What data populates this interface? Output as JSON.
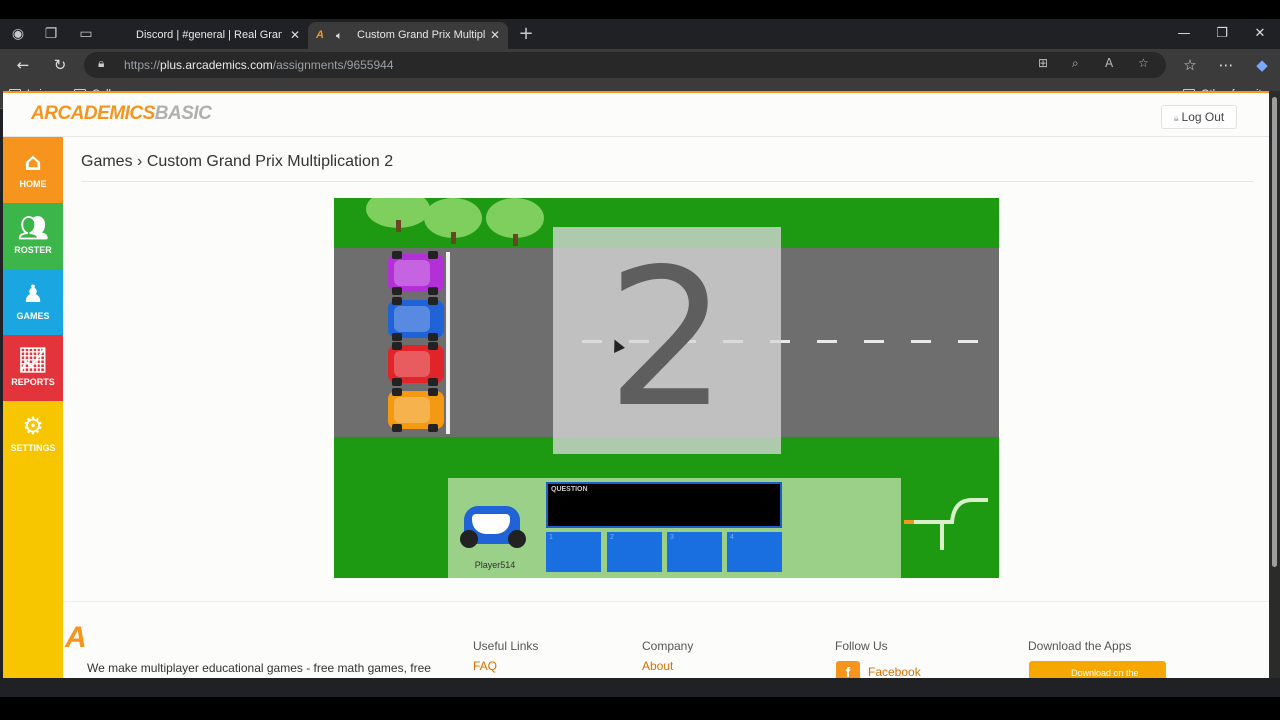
{
  "browser": {
    "tabs": [
      {
        "title": "Discord | #general | Real Grand Pr",
        "active": false
      },
      {
        "title": "Custom Grand Prix Multiplicati",
        "active": true
      }
    ],
    "url_prefix": "https://",
    "url_host": "plus.arcademics.com",
    "url_path": "/assignments/9655944",
    "bookmarks": [
      "Leisure",
      "College"
    ],
    "other_favorites": "Other favorites"
  },
  "header": {
    "logo_main": "ARCADEMICS",
    "logo_suffix": "BASIC",
    "logout": "Log Out"
  },
  "sidebar": {
    "items": [
      {
        "label": "HOME",
        "icon": "home-icon",
        "color": "#f7941d"
      },
      {
        "label": "ROSTER",
        "icon": "roster-icon",
        "color": "#3cb54a"
      },
      {
        "label": "GAMES",
        "icon": "games-icon",
        "color": "#1aa6e0"
      },
      {
        "label": "REPORTS",
        "icon": "reports-icon",
        "color": "#e2343a"
      },
      {
        "label": "SETTINGS",
        "icon": "gear-icon",
        "color": "#f7c600"
      }
    ]
  },
  "breadcrumb": {
    "parent": "Games",
    "separator": "›",
    "current": "Custom Grand Prix Multiplication 2"
  },
  "game": {
    "countdown": "2",
    "question_label": "QUESTION",
    "answers": [
      "1",
      "2",
      "3",
      "4"
    ],
    "player_name": "Player514",
    "car_colors": [
      "#b32fd6",
      "#1f63d6",
      "#e0242a",
      "#f39a12"
    ]
  },
  "footer": {
    "tagline": "We make multiplayer educational games - free math games, free",
    "useful_links_heading": "Useful Links",
    "useful_links": [
      "FAQ"
    ],
    "company_heading": "Company",
    "company_links": [
      "About"
    ],
    "follow_heading": "Follow Us",
    "follow_links": [
      "Facebook"
    ],
    "apps_heading": "Download the Apps",
    "apps_button": "Download on the"
  }
}
